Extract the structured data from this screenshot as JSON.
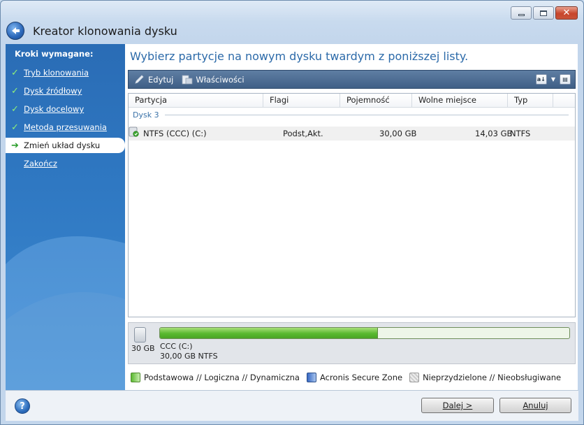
{
  "window": {
    "title": "Kreator klonowania dysku"
  },
  "sidebar": {
    "heading": "Kroki wymagane:",
    "items": [
      {
        "label": "Tryb klonowania",
        "state": "done"
      },
      {
        "label": "Dysk źródłowy",
        "state": "done"
      },
      {
        "label": "Dysk docelowy",
        "state": "done"
      },
      {
        "label": "Metoda przesuwania",
        "state": "done"
      },
      {
        "label": "Zmień układ dysku",
        "state": "current"
      },
      {
        "label": "Zakończ",
        "state": "pending"
      }
    ]
  },
  "main": {
    "heading": "Wybierz partycje na nowym dysku twardym z poniższej listy.",
    "toolbar": {
      "edit_label": "Edytuj",
      "properties_label": "Właściwości"
    },
    "table": {
      "columns": [
        "Partycja",
        "Flagi",
        "Pojemność",
        "Wolne miejsce",
        "Typ"
      ],
      "group_label": "Dysk 3",
      "rows": [
        {
          "partition": "NTFS (CCC) (C:)",
          "flags": "Podst,Akt.",
          "capacity": "30,00 GB",
          "free": "14,03 GB",
          "type": "NTFS"
        }
      ]
    },
    "disk_map": {
      "disk_size": "30 GB",
      "partition_name": "CCC (C:)",
      "partition_info": "30,00 GB  NTFS",
      "used_fraction": 0.532
    },
    "legend": {
      "basic": "Podstawowa // Logiczna // Dynamiczna",
      "secure_zone": "Acronis Secure Zone",
      "unallocated": "Nieprzydzielone // Nieobsługiwane"
    }
  },
  "footer": {
    "help_label": "?",
    "next_label": "Dalej >",
    "cancel_label": "Anuluj"
  },
  "colors": {
    "sidebar_blue": "#2f78c2",
    "heading_blue": "#2c6aa9",
    "partition_green": "#58b82f"
  }
}
